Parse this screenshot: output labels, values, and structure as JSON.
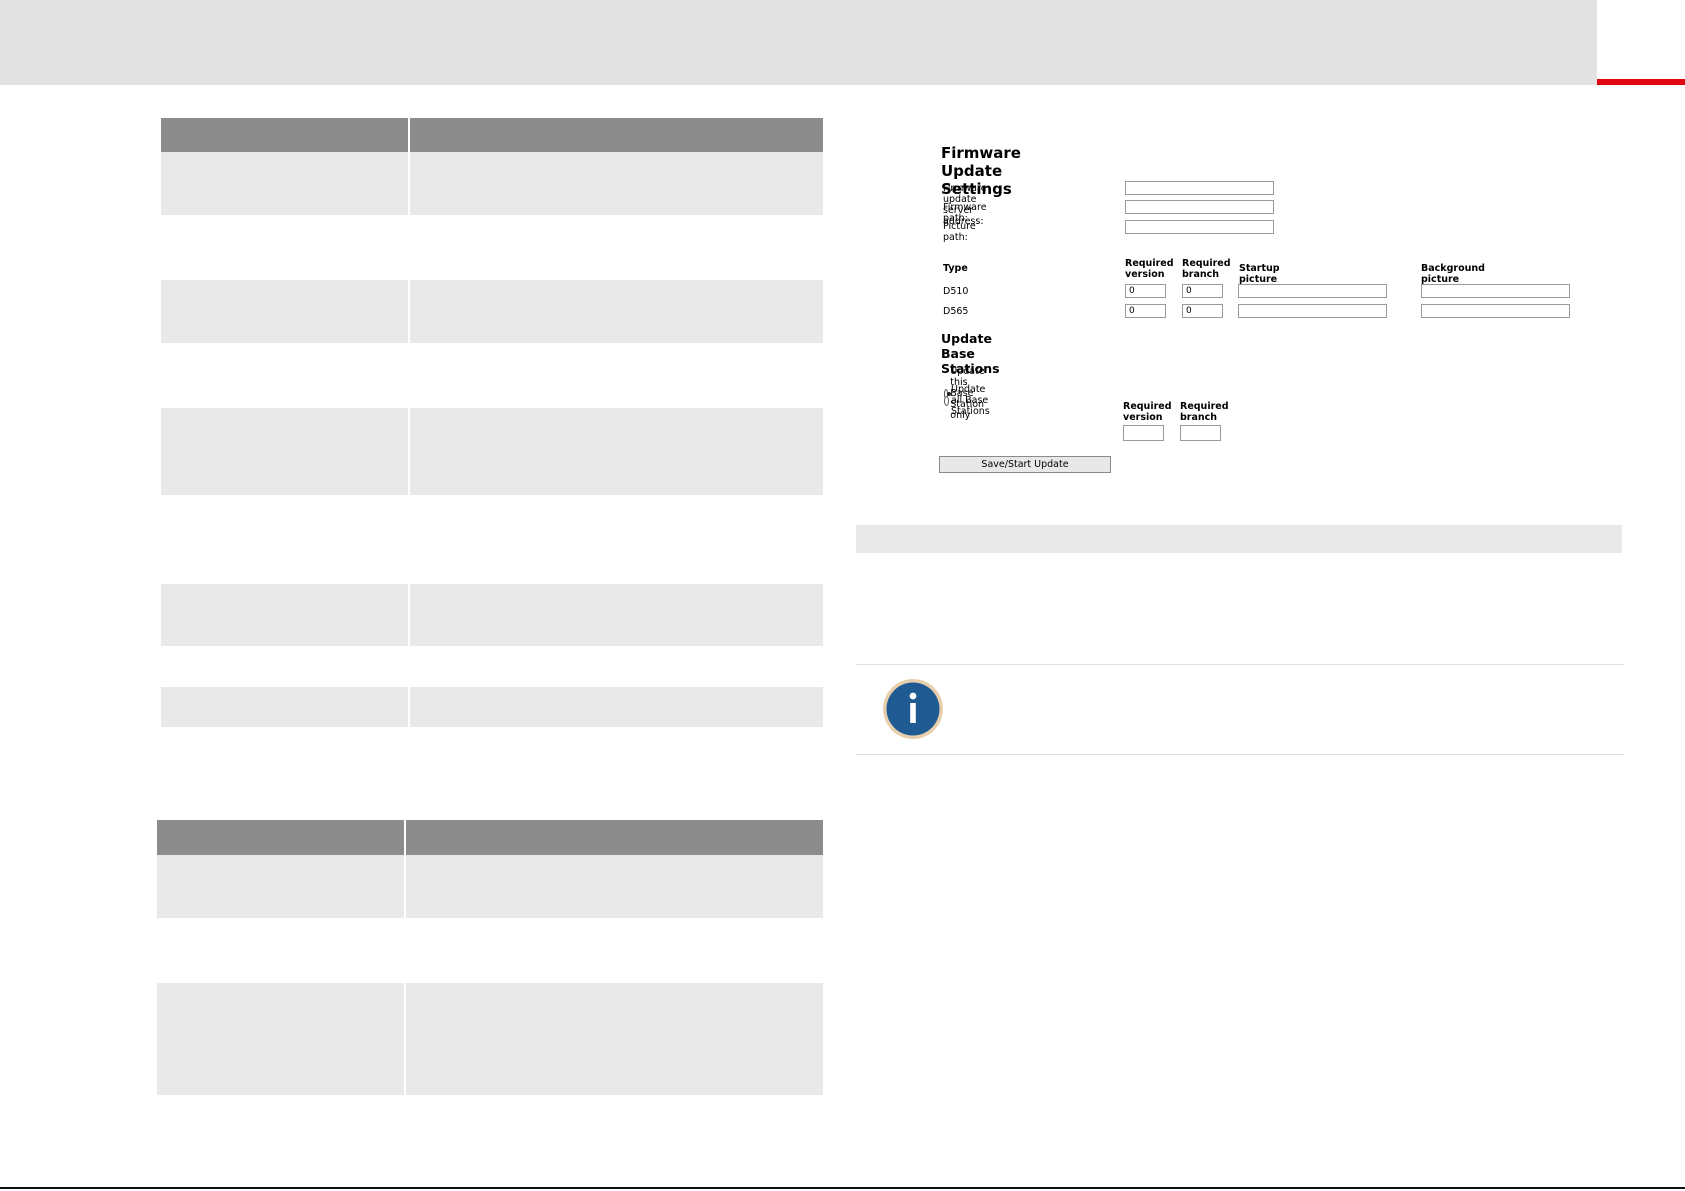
{
  "firmware": {
    "title": "Firmware Update Settings",
    "server_label": "Firmware update server address:",
    "server_value": "",
    "fw_path_label": "Firmware path:",
    "fw_path_value": "",
    "pic_path_label": "Picture path:",
    "pic_path_value": "",
    "columns": {
      "type": "Type",
      "req_version": "Required version",
      "req_branch": "Required branch",
      "startup": "Startup picture",
      "background": "Background picture"
    },
    "rows": [
      {
        "type": "D510",
        "version": "0",
        "branch": "0",
        "startup": "",
        "background": ""
      },
      {
        "type": "D565",
        "version": "0",
        "branch": "0",
        "startup": "",
        "background": ""
      }
    ],
    "base_title": "Update Base Stations",
    "radio_this": "Update this Base Station only",
    "radio_all": "Update all Base Stations",
    "selected_option": "this",
    "base_req_version_label": "Required version",
    "base_req_branch_label": "Required branch",
    "base_version_value": "",
    "base_branch_value": "",
    "save_button": "Save/Start Update"
  },
  "colors": {
    "top_bar": "#e2e2e2",
    "accent_red": "#e30613",
    "table_header": "#8c8c8c",
    "row_shade": "#e9e9e9",
    "info_icon_blue": "#1f5b92",
    "info_icon_ring": "#e7cfae"
  },
  "icons": {
    "info": "info-icon"
  }
}
